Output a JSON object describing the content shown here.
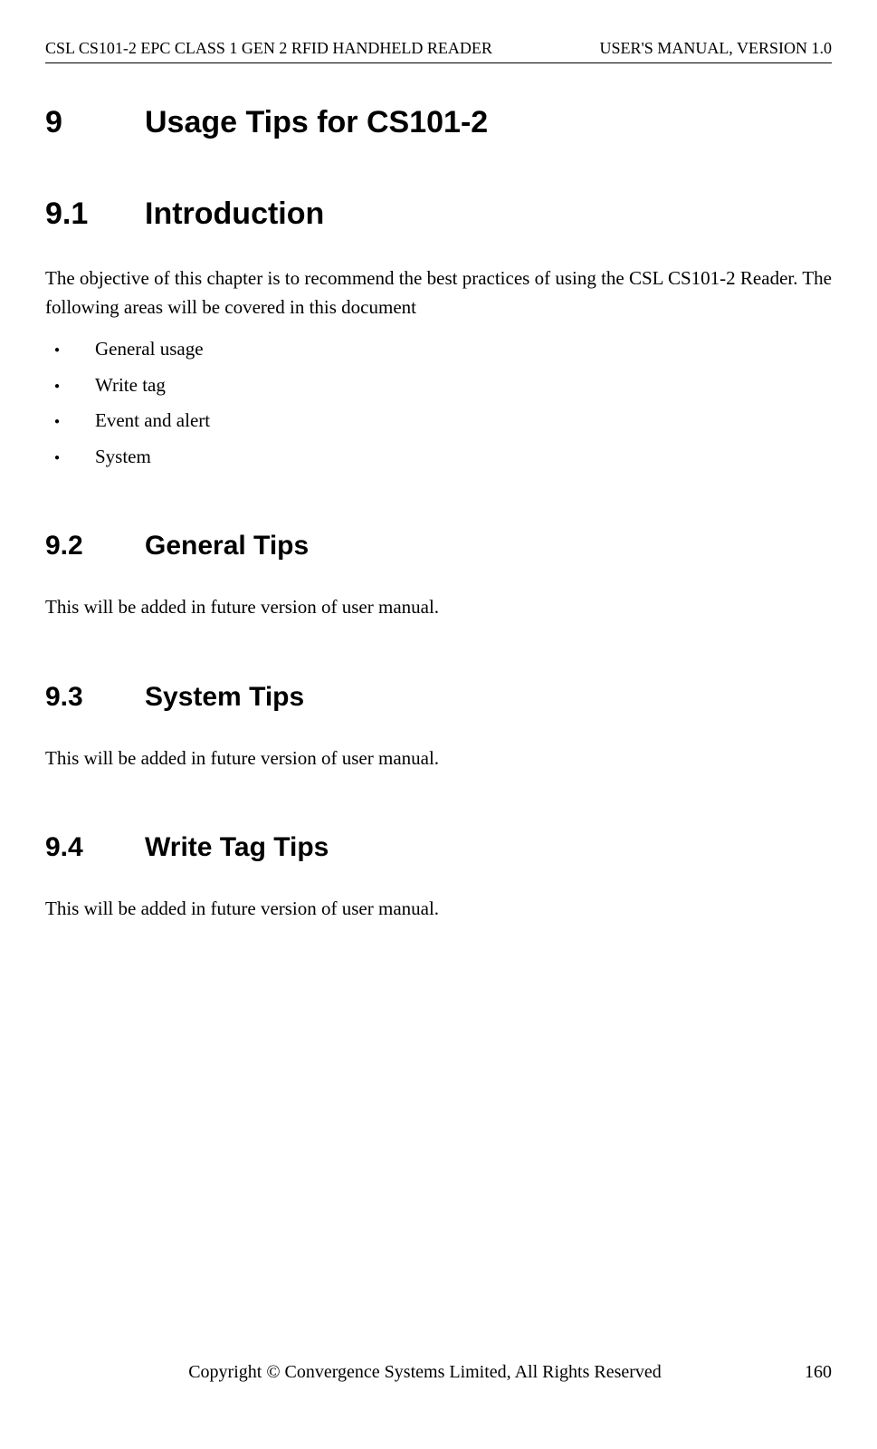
{
  "header": {
    "left": "CSL CS101-2 EPC CLASS 1 GEN 2 RFID HANDHELD READER",
    "right": "USER'S  MANUAL,  VERSION  1.0"
  },
  "chapter": {
    "number": "9",
    "title": "Usage Tips for CS101-2"
  },
  "sections": {
    "intro": {
      "number": "9.1",
      "title": "Introduction",
      "body": "The objective of this chapter is to recommend the best practices of using the CSL CS101-2 Reader. The following areas will be covered in this document",
      "bullets": [
        "General usage",
        "Write tag",
        "Event and alert",
        "System"
      ]
    },
    "general": {
      "number": "9.2",
      "title": "General Tips",
      "body": "This will be added in future version of user manual."
    },
    "system": {
      "number": "9.3",
      "title": "System Tips",
      "body": "This will be added in future version of user manual."
    },
    "write": {
      "number": "9.4",
      "title": "Write Tag Tips",
      "body": "This will be added in future version of user manual."
    }
  },
  "footer": {
    "copyright": "Copyright © Convergence Systems Limited, All Rights Reserved",
    "page": "160"
  }
}
